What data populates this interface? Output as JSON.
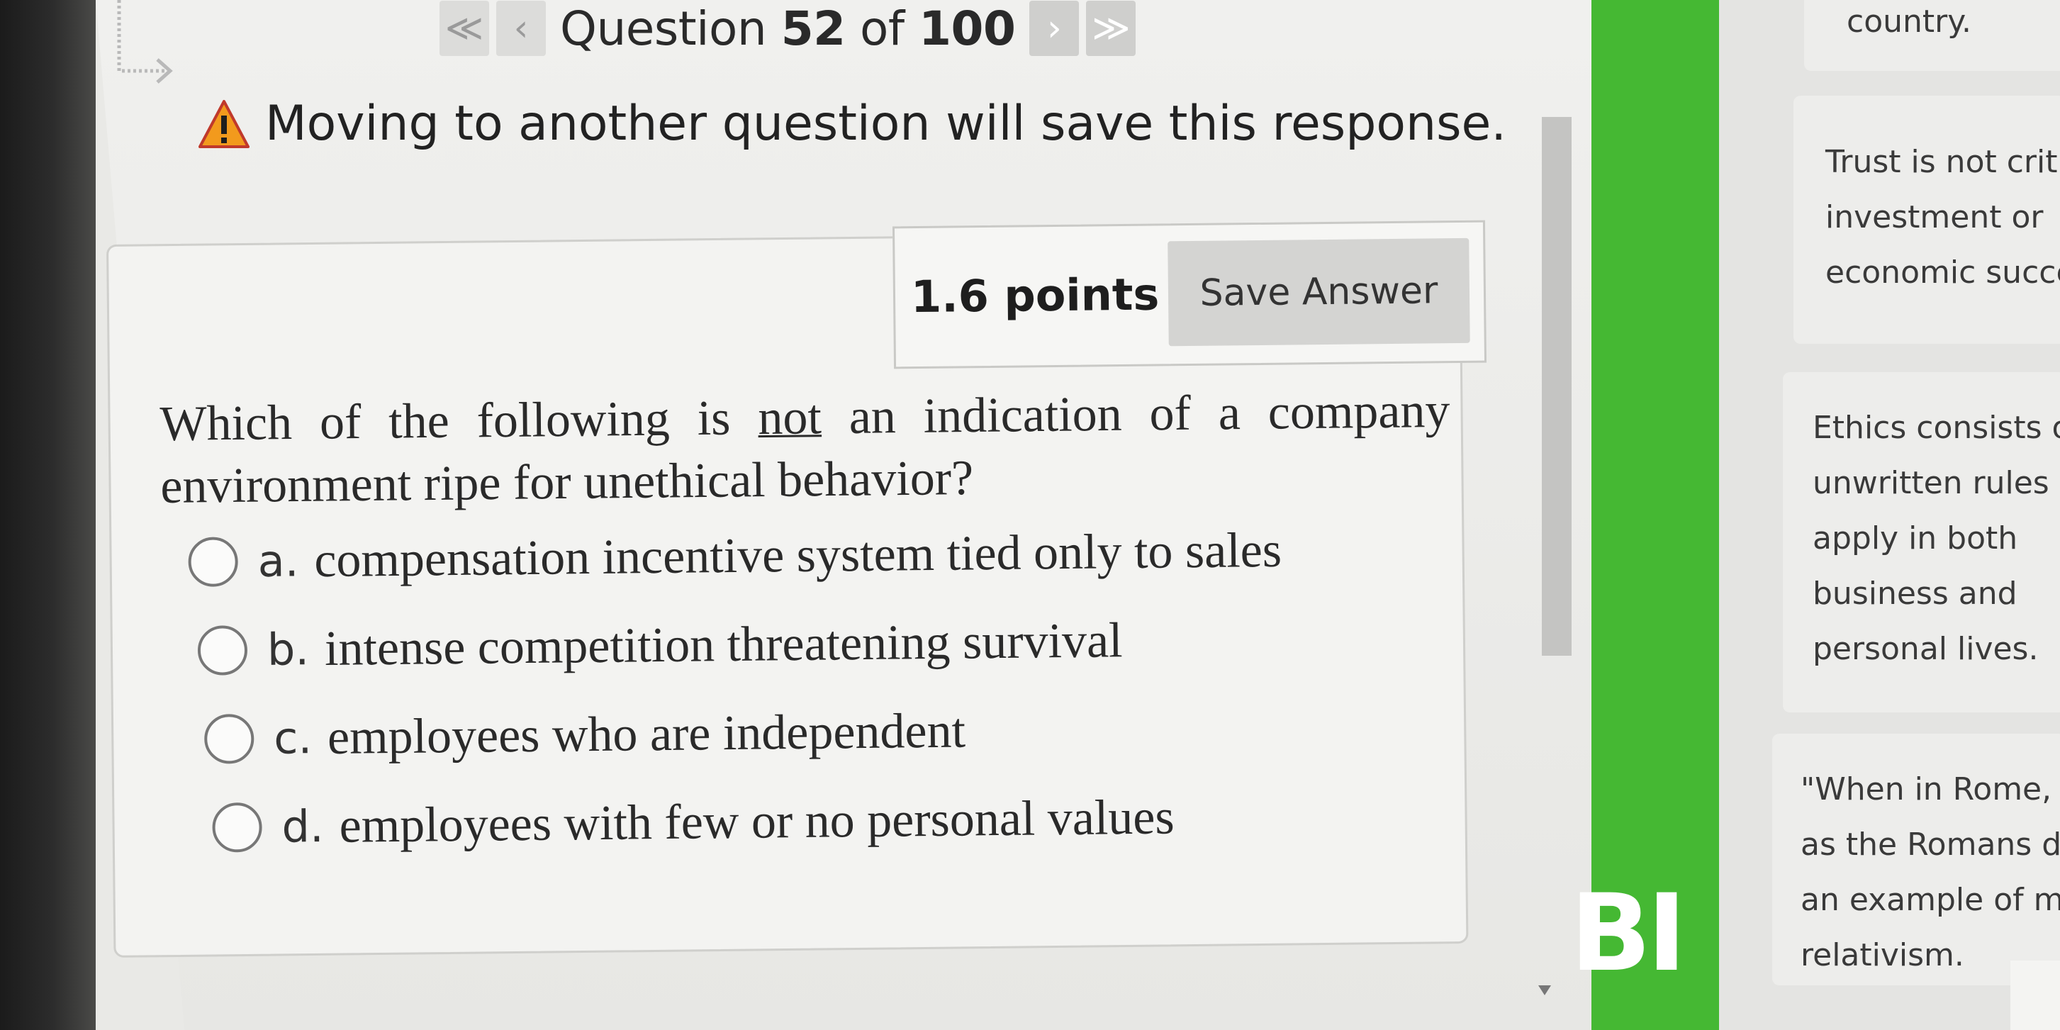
{
  "nav": {
    "first_icon": "≪",
    "prev_icon": "‹",
    "title_prefix": "Question ",
    "current": "52",
    "of_label": " of ",
    "total": "100",
    "next_icon": "›",
    "last_icon": "≫"
  },
  "warning": {
    "text": "Moving to another question will save this response."
  },
  "question": {
    "points": "1.6 points",
    "save_label": "Save Answer",
    "text_before": "Which of the following is ",
    "text_emph": "not",
    "text_after": " an indication of a company environment ripe for unethical behavior?",
    "options": [
      {
        "letter": "a.",
        "text": "compensation incentive system tied only to sales"
      },
      {
        "letter": "b.",
        "text": "intense competition threatening survival"
      },
      {
        "letter": "c.",
        "text": "employees who are independent"
      },
      {
        "letter": "d.",
        "text": "employees with few or no personal values"
      }
    ]
  },
  "green_panel": {
    "text": "BI"
  },
  "side_cards": [
    {
      "text": "country."
    },
    {
      "text": "Trust is not criti\ninvestment or\neconomic succe"
    },
    {
      "text": "Ethics consists of\nunwritten rules w\napply in both\nbusiness and\npersonal lives."
    },
    {
      "text": "\"When in Rome, do\nas the Romans do,\"\nan example of mora\nrelativism."
    }
  ],
  "colors": {
    "accent_green": "#45b833",
    "warning_orange": "#f29a1d"
  }
}
